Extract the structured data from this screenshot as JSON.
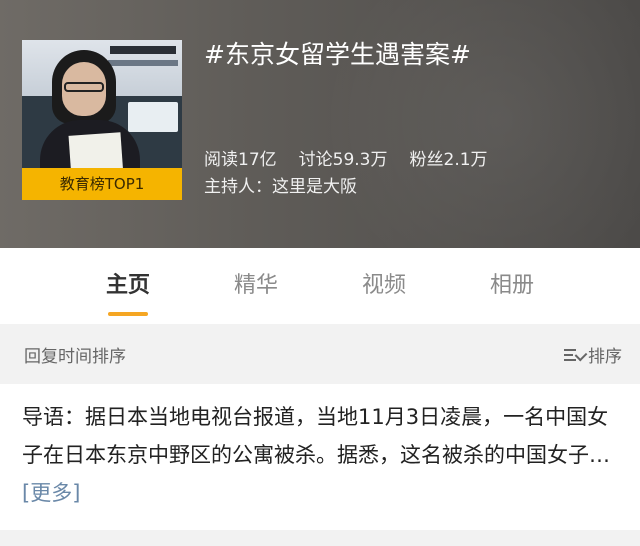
{
  "topic": {
    "cover_label": "教育榜TOP1",
    "title": "#东京女留学生遇害案#",
    "stats": {
      "reads": "阅读17亿",
      "discussions": "讨论59.3万",
      "fans": "粉丝2.1万"
    },
    "host": "主持人：这里是大阪"
  },
  "tabs": [
    {
      "label": "主页",
      "active": true
    },
    {
      "label": "精华",
      "active": false
    },
    {
      "label": "视频",
      "active": false
    },
    {
      "label": "相册",
      "active": false
    }
  ],
  "sort": {
    "label": "回复时间排序",
    "button_label": "排序",
    "icon": "sort-icon"
  },
  "intro": {
    "text": "导语：据日本当地电视台报道，当地11月3日凌晨，一名中国女子在日本东京中野区的公寓被杀。据悉，这名被杀的中国女子…",
    "more_label": "[更多]"
  },
  "colors": {
    "accent": "#f5a623",
    "badge": "#f5b400",
    "link": "#6a88a8"
  }
}
